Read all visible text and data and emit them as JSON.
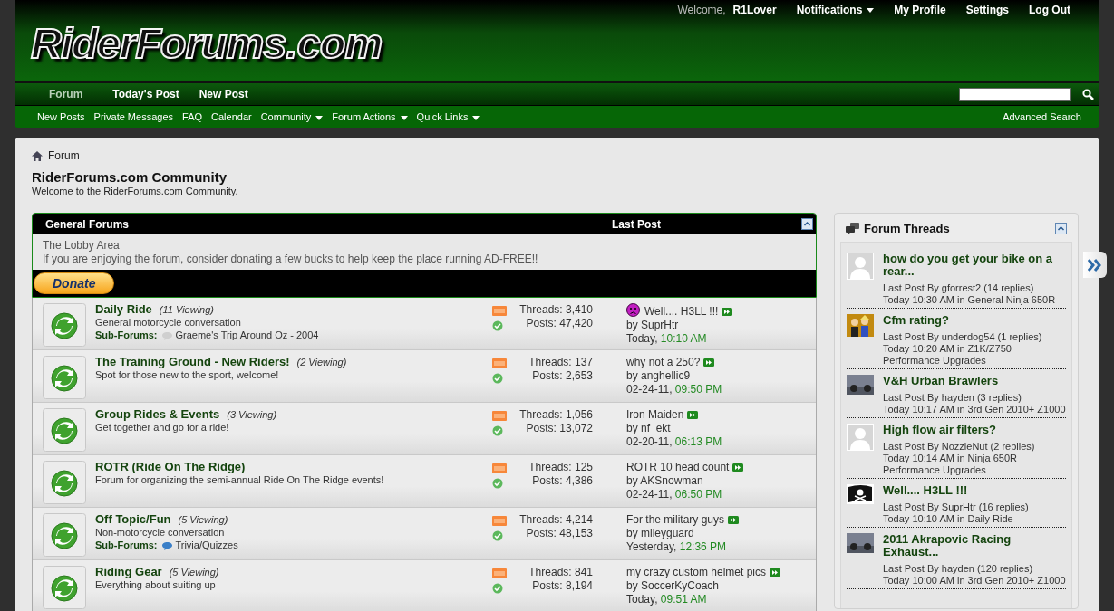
{
  "header": {
    "welcome": "Welcome,",
    "username": "R1Lover",
    "user_links": [
      {
        "label": "Notifications",
        "dropdown": true
      },
      {
        "label": "My Profile",
        "dropdown": false
      },
      {
        "label": "Settings",
        "dropdown": false
      },
      {
        "label": "Log Out",
        "dropdown": false
      }
    ],
    "logo": "RiderForums.com",
    "tabs": [
      {
        "label": "Forum",
        "selected": true
      },
      {
        "label": "Today's Post",
        "selected": false
      },
      {
        "label": "New Post",
        "selected": false
      }
    ],
    "subnav": [
      {
        "label": "New Posts",
        "dropdown": false
      },
      {
        "label": "Private Messages",
        "dropdown": false
      },
      {
        "label": "FAQ",
        "dropdown": false
      },
      {
        "label": "Calendar",
        "dropdown": false
      },
      {
        "label": "Community",
        "dropdown": true
      },
      {
        "label": "Forum Actions",
        "dropdown": true
      },
      {
        "label": "Quick Links",
        "dropdown": true
      }
    ],
    "advanced_search": "Advanced Search"
  },
  "breadcrumb": "Forum",
  "page_title": "RiderForums.com Community",
  "page_subtitle": "Welcome to the RiderForums.com Community.",
  "forum_block": {
    "title": "General Forums",
    "last_post_heading": "Last Post",
    "category": "The Lobby Area",
    "category_description": "If you are enjoying the forum, consider donating a few bucks to help keep the place running AD-FREE!!",
    "donate_button": "Donate",
    "forums": [
      {
        "title": "Daily Ride",
        "viewing": "(11 Viewing)",
        "description": "General motorcycle conversation",
        "subforums_label": "Sub-Forums:",
        "subforums": [
          {
            "name": "Graeme's Trip Around Oz - 2004",
            "new_posts": false
          }
        ],
        "threads": "Threads: 3,410",
        "posts": "Posts: 47,420",
        "last_post": {
          "title": "Well.... H3LL !!!",
          "post_icon": true,
          "by": "by SuprHtr",
          "date": "Today,",
          "time": "10:10 AM"
        }
      },
      {
        "title": "The Training Ground - New Riders!",
        "viewing": "(2 Viewing)",
        "description": "Spot for those new to the sport, welcome!",
        "threads": "Threads: 137",
        "posts": "Posts: 2,653",
        "last_post": {
          "title": "why not a 250?",
          "post_icon": false,
          "by": "by anghellic9",
          "date": "02-24-11,",
          "time": "09:50 PM"
        }
      },
      {
        "title": "Group Rides & Events",
        "viewing": "(3 Viewing)",
        "description": "Get together and go for a ride!",
        "threads": "Threads: 1,056",
        "posts": "Posts: 13,072",
        "last_post": {
          "title": "Iron Maiden",
          "post_icon": false,
          "by": "by nf_ekt",
          "date": "02-20-11,",
          "time": "06:13 PM"
        }
      },
      {
        "title": "ROTR (Ride On The Ridge)",
        "description": "Forum for organizing the semi-annual Ride On The Ridge events!",
        "threads": "Threads: 125",
        "posts": "Posts: 4,386",
        "last_post": {
          "title": "ROTR 10 head count",
          "post_icon": false,
          "by": "by AKSnowman",
          "date": "02-24-11,",
          "time": "06:50 PM"
        }
      },
      {
        "title": "Off Topic/Fun",
        "viewing": "(5 Viewing)",
        "description": "Non-motorcycle conversation",
        "subforums_label": "Sub-Forums:",
        "subforums": [
          {
            "name": "Trivia/Quizzes",
            "new_posts": true
          }
        ],
        "threads": "Threads: 4,214",
        "posts": "Posts: 48,153",
        "last_post": {
          "title": "For the military guys",
          "post_icon": false,
          "by": "by mileyguard",
          "date": "Yesterday,",
          "time": "12:36 PM"
        }
      },
      {
        "title": "Riding Gear",
        "viewing": "(5 Viewing)",
        "description": "Everything about suiting up",
        "threads": "Threads: 841",
        "posts": "Posts: 8,194",
        "last_post": {
          "title": "my crazy custom helmet pics",
          "post_icon": false,
          "by": "by SoccerKyCoach",
          "date": "Today,",
          "time": "09:51 AM"
        }
      }
    ]
  },
  "sidebar": {
    "title": "Forum Threads",
    "threads": [
      {
        "title": "how do you get your bike on a rear...",
        "kind": "avatar",
        "last_post": "Last Post By gforrest2 (14 replies)",
        "meta": "Today 10:30 AM in General Ninja 650R"
      },
      {
        "title": "Cfm rating?",
        "kind": "cartoon",
        "last_post": "Last Post By underdog54 (1 replies)",
        "meta": "Today 10:20 AM in Z1K/Z750 Performance Upgrades"
      },
      {
        "title": "V&H Urban Brawlers",
        "kind": "photo",
        "last_post": "Last Post By hayden (3 replies)",
        "meta": "Today 10:17 AM in 3rd Gen 2010+ Z1000"
      },
      {
        "title": "High flow air filters?",
        "kind": "avatar",
        "last_post": "Last Post By NozzleNut (2 replies)",
        "meta": "Today 10:14 AM in Ninja 650R Performance Upgrades"
      },
      {
        "title": "Well.... H3LL !!!",
        "kind": "flag",
        "last_post": "Last Post By SuprHtr (16 replies)",
        "meta": "Today 10:10 AM in Daily Ride"
      },
      {
        "title": "2011 Akrapovic Racing Exhaust...",
        "kind": "photo",
        "last_post": "Last Post By hayden (120 replies)",
        "meta": "Today 10:00 AM in 3rd Gen 2010+ Z1000"
      }
    ]
  }
}
